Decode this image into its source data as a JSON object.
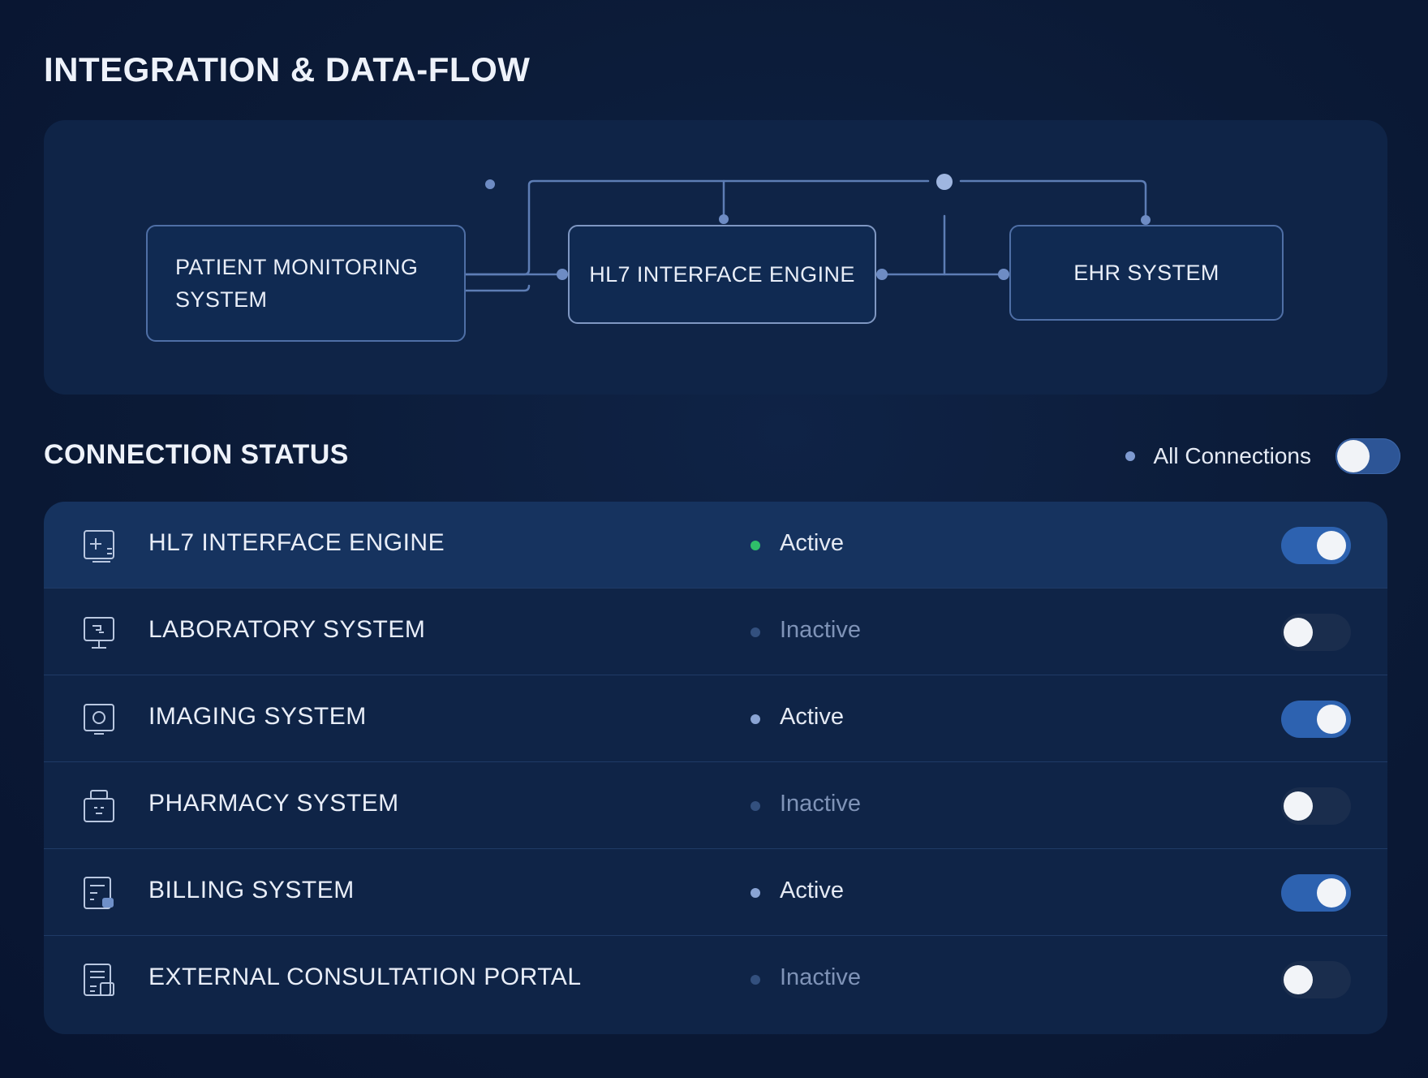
{
  "page": {
    "title": "INTEGRATION & DATA-FLOW"
  },
  "flow": {
    "nodes": {
      "patient": "PATIENT MONITORING\nSYSTEM",
      "hl7": "HL7 INTERFACE ENGINE",
      "ehr": "EHR SYSTEM"
    }
  },
  "connection_status": {
    "title": "CONNECTION STATUS",
    "all_label": "All Connections",
    "all_enabled": true,
    "rows": [
      {
        "name": "HL7 INTERFACE ENGINE",
        "status": "Active",
        "enabled": true,
        "icon": "medical-plus-icon"
      },
      {
        "name": "LABORATORY SYSTEM",
        "status": "Inactive",
        "enabled": false,
        "icon": "monitor-icon"
      },
      {
        "name": "IMAGING SYSTEM",
        "status": "Active",
        "enabled": true,
        "icon": "imaging-icon"
      },
      {
        "name": "PHARMACY SYSTEM",
        "status": "Inactive",
        "enabled": false,
        "icon": "pharmacy-icon"
      },
      {
        "name": "BILLING SYSTEM",
        "status": "Active",
        "enabled": true,
        "icon": "billing-icon"
      },
      {
        "name": "EXTERNAL CONSULTATION PORTAL",
        "status": "Inactive",
        "enabled": false,
        "icon": "portal-icon"
      }
    ]
  },
  "colors": {
    "background": "#0b1a36",
    "panel": "#0f2447",
    "accent": "#2d62b0",
    "active_dot": "#2fbf6a",
    "connector": "#5d7db5"
  }
}
